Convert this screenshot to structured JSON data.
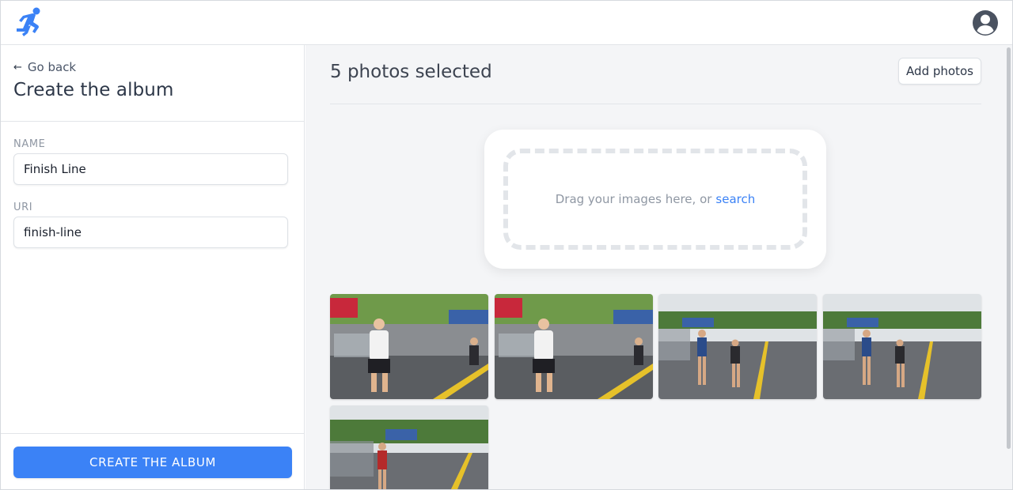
{
  "app": {
    "logo_icon": "running-person-icon",
    "user_icon": "user-circle-icon",
    "accent_color": "#3b82f6"
  },
  "sidebar": {
    "back_label": "Go back",
    "back_icon": "arrow-left-icon",
    "title": "Create the album",
    "fields": [
      {
        "label": "NAME",
        "value": "Finish Line",
        "placeholder": ""
      },
      {
        "label": "URI",
        "value": "finish-line",
        "placeholder": ""
      }
    ],
    "submit_label": "CREATE THE ALBUM"
  },
  "main": {
    "title": "5 photos selected",
    "add_photos_label": "Add photos",
    "dropzone": {
      "text": "Drag your images here, or",
      "link_text": "search"
    },
    "photos": [
      {
        "alt": "Runner in white tank top near finish line"
      },
      {
        "alt": "Runner in white tank top near finish line"
      },
      {
        "alt": "Two runners on road"
      },
      {
        "alt": "Two runners on road"
      },
      {
        "alt": "Runner in red shirt on road"
      }
    ]
  }
}
